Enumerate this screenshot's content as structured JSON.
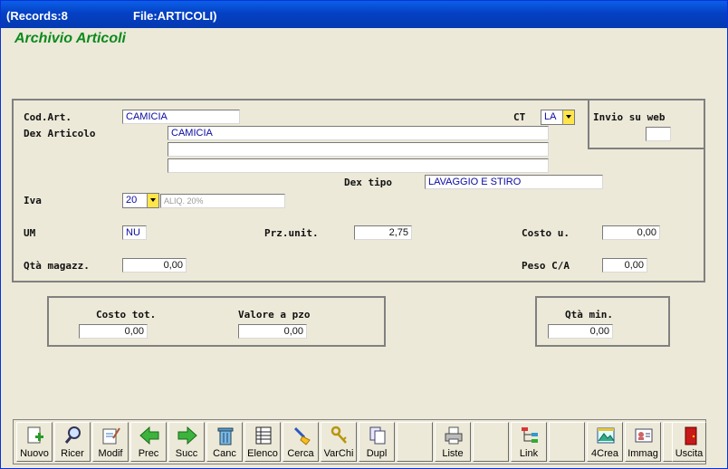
{
  "window": {
    "records": "(Records:8",
    "file": "File:ARTICOLI)"
  },
  "app_title": "Archivio Articoli",
  "form": {
    "cod_art": {
      "label": "Cod.Art.",
      "value": "CAMICIA"
    },
    "ct": {
      "label": "CT",
      "value": "LA"
    },
    "invio_web": {
      "label": "Invio su web",
      "value": ""
    },
    "dex_articolo": {
      "label": "Dex Articolo",
      "line1": "CAMICIA",
      "line2": "",
      "line3": ""
    },
    "dex_tipo": {
      "label": "Dex tipo",
      "value": "LAVAGGIO E STIRO"
    },
    "iva": {
      "label": "Iva",
      "value": "20",
      "desc": "ALIQ. 20%"
    },
    "um": {
      "label": "UM",
      "value": "NU"
    },
    "prz_unit": {
      "label": "Prz.unit.",
      "value": "2,75"
    },
    "costo_u": {
      "label": "Costo u.",
      "value": "0,00"
    },
    "qta_magazz": {
      "label": "Qtà magazz.",
      "value": "0,00"
    },
    "peso_ca": {
      "label": "Peso C/A",
      "value": "0,00"
    }
  },
  "totals": {
    "costo_tot": {
      "label": "Costo tot.",
      "value": "0,00"
    },
    "valore_pzo": {
      "label": "Valore a pzo",
      "value": "0,00"
    },
    "qta_min": {
      "label": "Qtà min.",
      "value": "0,00"
    }
  },
  "toolbar": [
    {
      "label": "Nuovo",
      "icon": "new-document-icon"
    },
    {
      "label": "Ricer",
      "icon": "magnifier-icon"
    },
    {
      "label": "Modif",
      "icon": "edit-document-icon"
    },
    {
      "label": "Prec",
      "icon": "arrow-left-icon"
    },
    {
      "label": "Succ",
      "icon": "arrow-right-icon"
    },
    {
      "label": "Canc",
      "icon": "trash-icon"
    },
    {
      "label": "Elenco",
      "icon": "list-grid-icon"
    },
    {
      "label": "Cerca",
      "icon": "brush-icon"
    },
    {
      "label": "VarChi",
      "icon": "keys-icon"
    },
    {
      "label": "Dupl",
      "icon": "duplicate-icon"
    },
    {
      "label": "",
      "icon": ""
    },
    {
      "label": "Liste",
      "icon": "printer-icon"
    },
    {
      "label": "",
      "icon": ""
    },
    {
      "label": "Link",
      "icon": "link-tree-icon"
    },
    {
      "label": "",
      "icon": ""
    },
    {
      "label": "4Crea",
      "icon": "image-frame-icon"
    },
    {
      "label": "Immag",
      "icon": "contact-card-icon"
    },
    {
      "label": "",
      "icon": ""
    },
    {
      "label": "Uscita",
      "icon": "exit-door-icon"
    }
  ]
}
